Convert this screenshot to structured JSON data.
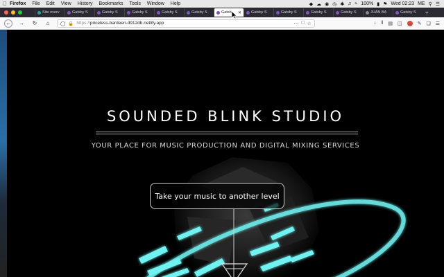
{
  "menubar": {
    "app": "Firefox",
    "items": [
      "File",
      "Edit",
      "View",
      "History",
      "Bookmarks",
      "Tools",
      "Window",
      "Help"
    ],
    "battery": "100%",
    "clock": "Wed 02:23",
    "user": "ME"
  },
  "tabs": [
    {
      "label": "Site overv",
      "favicon": "teal"
    },
    {
      "label": "Gatsby S",
      "favicon": "purple"
    },
    {
      "label": "Gatsby S",
      "favicon": "purple"
    },
    {
      "label": "Gatsby S",
      "favicon": "purple"
    },
    {
      "label": "Gatsby S",
      "favicon": "purple"
    },
    {
      "label": "Gatsby S",
      "favicon": "purple"
    },
    {
      "label": "Gatsb",
      "favicon": "purple",
      "active": true
    },
    {
      "label": "Gatsby S",
      "favicon": "purple"
    },
    {
      "label": "Gatsby S",
      "favicon": "purple"
    },
    {
      "label": "Gatsby S",
      "favicon": "purple"
    },
    {
      "label": "Gatsby S",
      "favicon": "purple"
    },
    {
      "label": "Gatsby S",
      "favicon": "purple"
    },
    {
      "label": "JUAN BA",
      "favicon": "gray"
    },
    {
      "label": "Gatsby S",
      "favicon": "purple"
    }
  ],
  "urlbar": {
    "protocol": "https://",
    "host": "priceless-bardeen-d912db.netlify.app"
  },
  "hero": {
    "title": "SOUNDED BLINK STUDIO",
    "subtitle": "YOUR PLACE FOR MUSIC PRODUCTION AND DIGITAL MIXING SERVICES",
    "cta": "Take your music to another level"
  },
  "colors": {
    "accent_glow": "#6ff2f0",
    "background": "#000000"
  }
}
